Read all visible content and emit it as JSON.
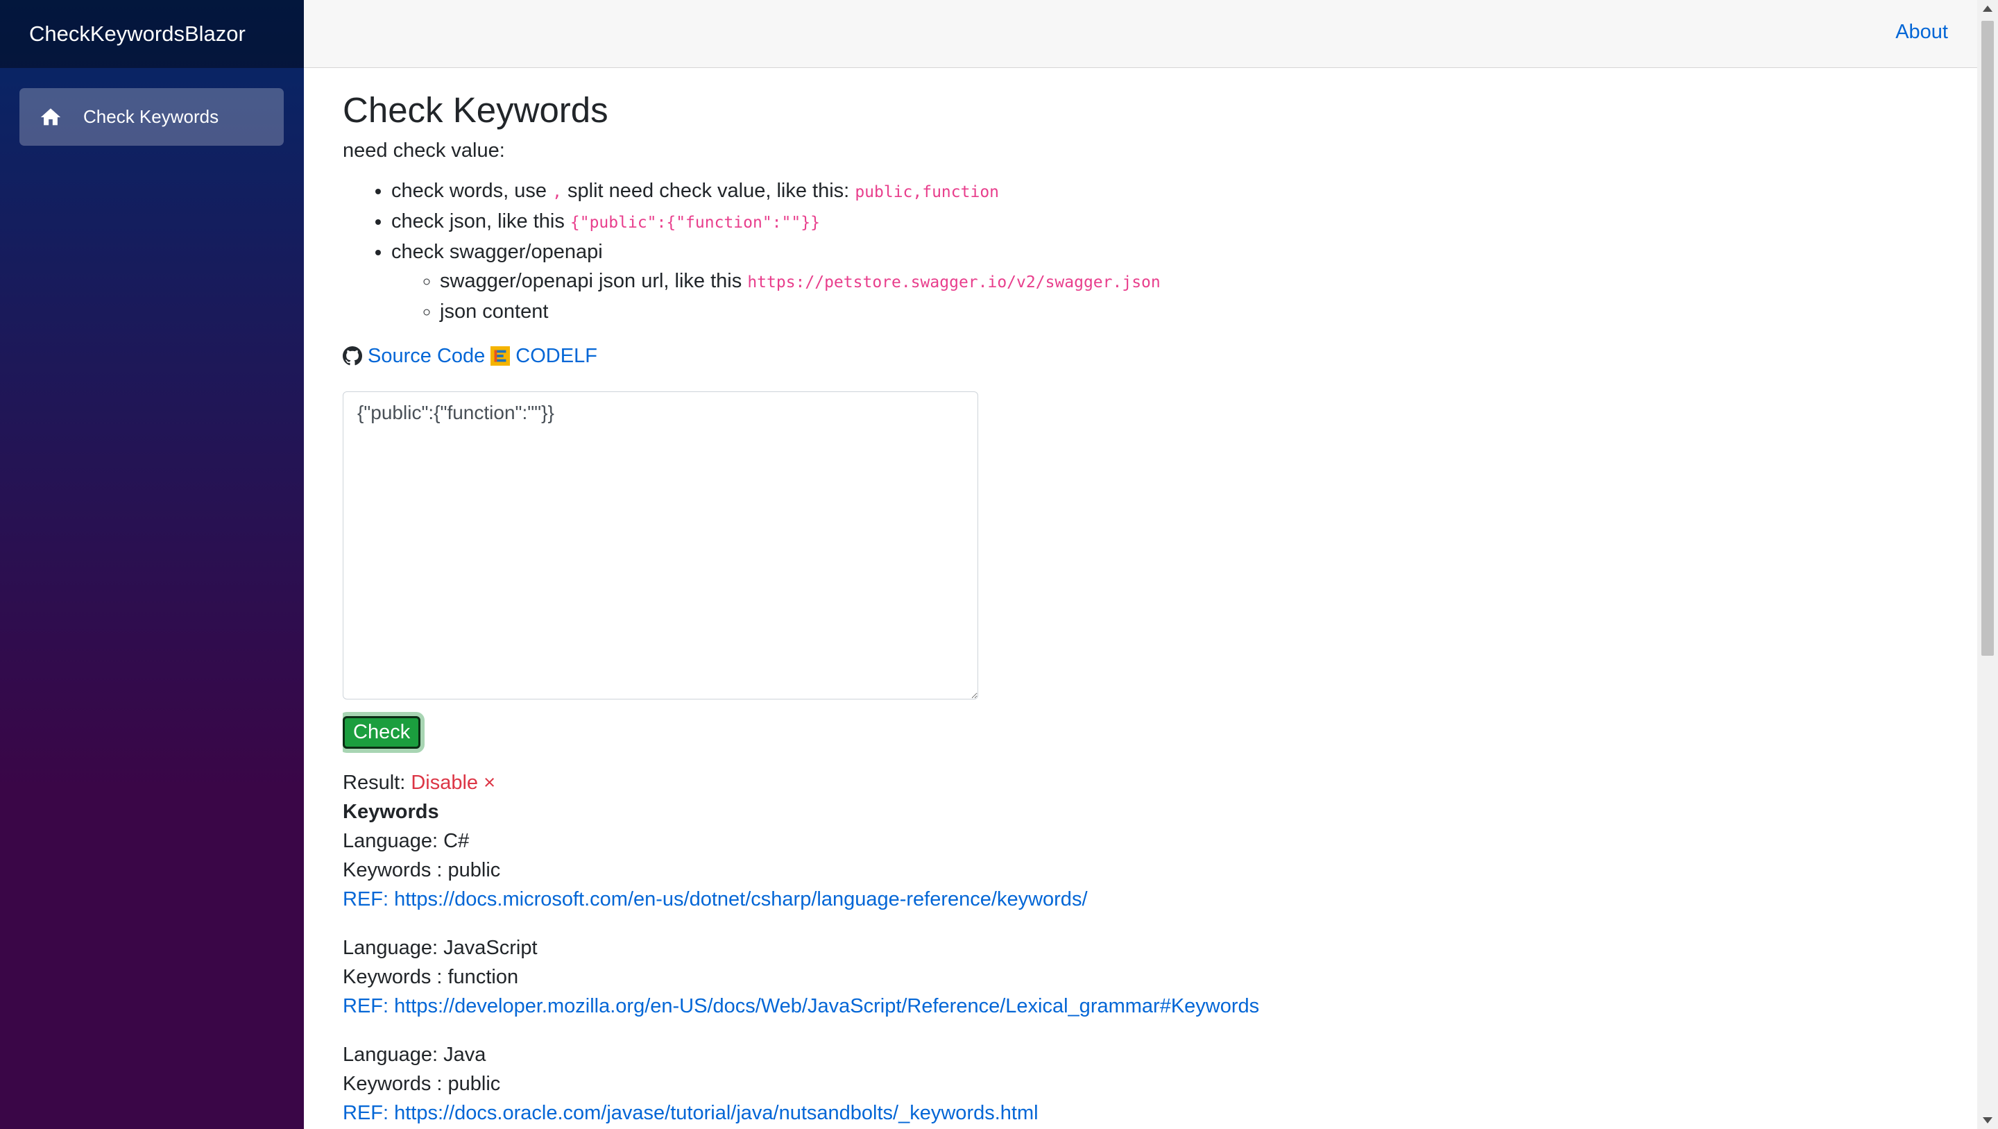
{
  "app": {
    "brand": "CheckKeywordsBlazor"
  },
  "sidebar": {
    "items": [
      {
        "label": "Check Keywords",
        "icon": "home-icon"
      }
    ]
  },
  "topbar": {
    "about": "About"
  },
  "main": {
    "title": "Check Keywords",
    "intro": "need check value:",
    "bullets": {
      "b1_pre": "check words, use",
      "b1_code": ",",
      "b1_mid": "split need check value, like this:",
      "b1_example": "public,function",
      "b2_pre": "check json, like this",
      "b2_example": "{\"public\":{\"function\":\"\"}}",
      "b3": "check swagger/openapi",
      "b3_sub1_pre": "swagger/openapi json url, like this",
      "b3_sub1_example": "https://petstore.swagger.io/v2/swagger.json",
      "b3_sub2": "json content"
    },
    "links": {
      "source_code": "Source Code",
      "codelf": "CODELF"
    },
    "input": {
      "value": "{\"public\":{\"function\":\"\"}}"
    },
    "check_button": "Check",
    "result": {
      "label": "Result:",
      "value": "Disable ×"
    },
    "keywords_title": "Keywords",
    "languages": [
      {
        "language": "Language: C#",
        "keywords": "Keywords : public",
        "ref": "REF: https://docs.microsoft.com/en-us/dotnet/csharp/language-reference/keywords/"
      },
      {
        "language": "Language: JavaScript",
        "keywords": "Keywords : function",
        "ref": "REF: https://developer.mozilla.org/en-US/docs/Web/JavaScript/Reference/Lexical_grammar#Keywords"
      },
      {
        "language": "Language: Java",
        "keywords": "Keywords : public",
        "ref": "REF: https://docs.oracle.com/javase/tutorial/java/nutsandbolts/_keywords.html"
      }
    ]
  },
  "colors": {
    "link": "#0366d6",
    "code": "#e83e8c",
    "danger": "#dc3545",
    "success": "#1b9e3e"
  }
}
